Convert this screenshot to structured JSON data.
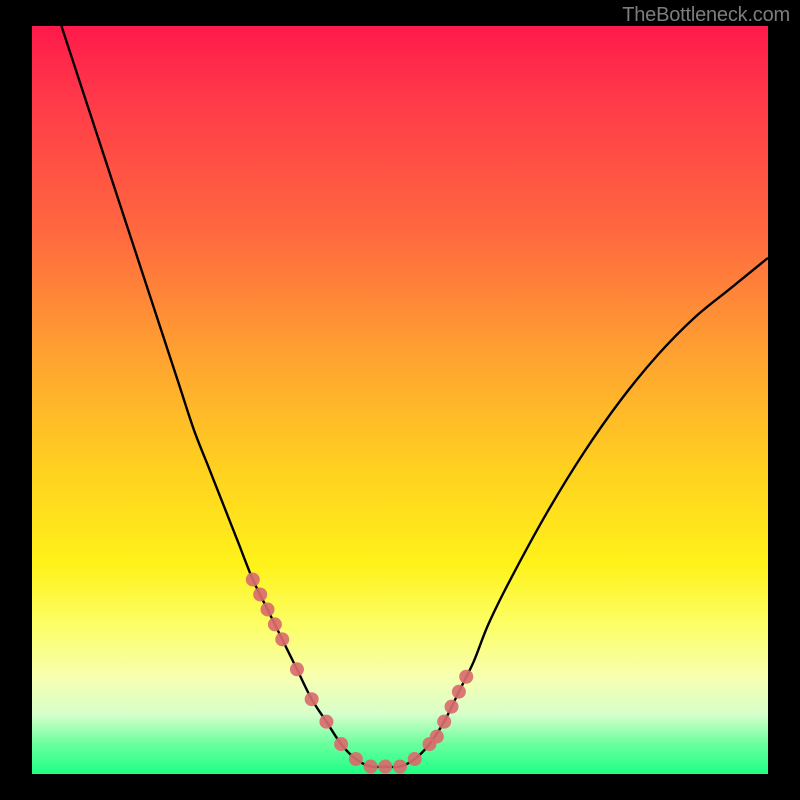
{
  "watermark": "TheBottleneck.com",
  "chart_data": {
    "type": "line",
    "title": "",
    "xlabel": "",
    "ylabel": "",
    "xlim": [
      0,
      100
    ],
    "ylim": [
      0,
      100
    ],
    "grid": false,
    "series": [
      {
        "name": "curve",
        "x": [
          4,
          6,
          8,
          10,
          12,
          14,
          16,
          18,
          20,
          22,
          24,
          26,
          28,
          30,
          32,
          34,
          36,
          38,
          40,
          42,
          44,
          46,
          48,
          50,
          52,
          54,
          56,
          58,
          60,
          62,
          65,
          70,
          75,
          80,
          85,
          90,
          95,
          100
        ],
        "y": [
          100,
          94,
          88,
          82,
          76,
          70,
          64,
          58,
          52,
          46,
          41,
          36,
          31,
          26,
          22,
          18,
          14,
          10,
          7,
          4,
          2,
          1,
          1,
          1,
          2,
          4,
          7,
          11,
          15,
          20,
          26,
          35,
          43,
          50,
          56,
          61,
          65,
          69
        ]
      }
    ],
    "scatter_points": {
      "name": "markers",
      "x": [
        30,
        31,
        32,
        33,
        34,
        36,
        38,
        40,
        42,
        44,
        46,
        48,
        50,
        52,
        54,
        55,
        56,
        57,
        58,
        59
      ],
      "y": [
        26,
        24,
        22,
        20,
        18,
        14,
        10,
        7,
        4,
        2,
        1,
        1,
        1,
        2,
        4,
        5,
        7,
        9,
        11,
        13
      ]
    },
    "colors": {
      "curve": "#000000",
      "markers": "#d96d6d"
    }
  }
}
